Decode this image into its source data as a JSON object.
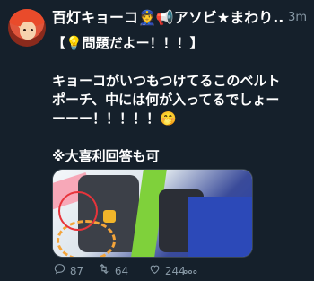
{
  "author": {
    "display_name": "百灯キョーコ👮📢アソビ★まわり...",
    "timestamp": "3m"
  },
  "tweet": {
    "lines": [
      "【💡問題だよー！！！】",
      "",
      "キョーコがいつもつけてるこのベルト",
      "ポーチ、中には何が入ってるでしょー",
      "ーーー！！！！！🤭",
      "",
      "※大喜利回答も可"
    ]
  },
  "stats": {
    "replies": "87",
    "retweets": "64",
    "likes": "244"
  },
  "icons": {
    "reply": "reply-icon",
    "retweet": "retweet-icon",
    "like": "heart-icon",
    "more": "more-icon"
  },
  "colors": {
    "background": "#15202b",
    "secondary_text": "#8899a6"
  }
}
